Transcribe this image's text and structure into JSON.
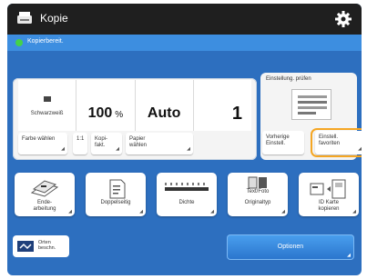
{
  "header": {
    "title": "Kopie"
  },
  "status": {
    "text": "Kopierbereit."
  },
  "summary": {
    "color_mode": "Schwarzweiß",
    "zoom_value": "100",
    "zoom_unit": "%",
    "paper": "Auto",
    "copies": "1"
  },
  "quick_buttons": [
    {
      "label": "Farbe wählen"
    },
    {
      "label": "1:1"
    },
    {
      "label": "Kopi-\nfakt."
    },
    {
      "label": "Papier\nwählen"
    }
  ],
  "preview": {
    "label": "Einstellung. prüfen",
    "previous_settings": "Vorherige\nEinstell.",
    "favorites": "Einstell.\nfavoriten"
  },
  "function_buttons": [
    {
      "label": "Ende-\narbeitung"
    },
    {
      "label": "Doppelseitig"
    },
    {
      "label": "Dichte"
    },
    {
      "label": "Originaltyp",
      "top_label": "Text/Foto"
    },
    {
      "label": "ID Karte\nkopieren"
    }
  ],
  "bottom": {
    "left_label": "Orten\nbeschn.",
    "start_label": "Optionen"
  },
  "colors": {
    "screen_bg": "#2d6fbf",
    "topbar_bg": "#1f1f1f",
    "status_bg": "#3d8ee0",
    "status_dot": "#44d24a",
    "highlight": "#f5a623"
  },
  "icons": {
    "app": "copy-machine-icon",
    "gear": "gear-icon"
  }
}
